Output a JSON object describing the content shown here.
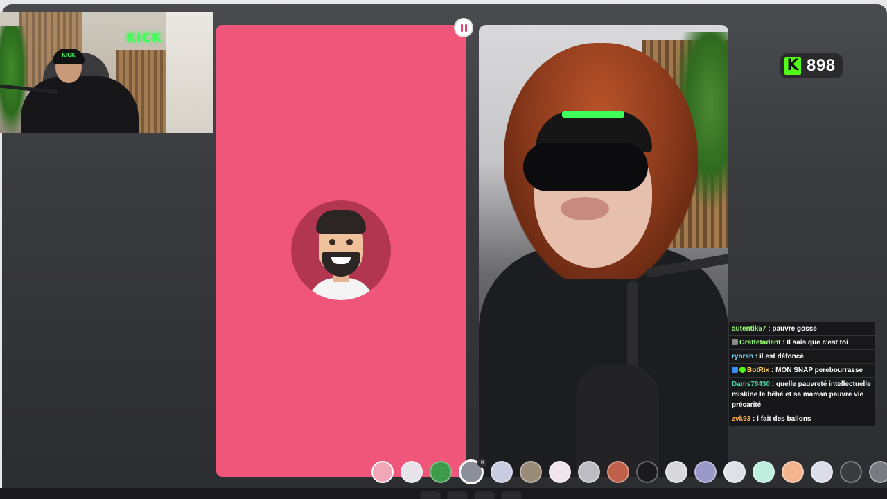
{
  "stream": {
    "viewer_count": "898",
    "kick_logo_letter": "K",
    "webcam_sign": "KICK",
    "webcam_cap": "KICK"
  },
  "call": {
    "pause_icon": "pause-icon",
    "accent_color": "#f0567a"
  },
  "chat": {
    "messages": [
      {
        "user": "autentik57",
        "text": " : pauvre gosse",
        "color": "#9cff7a",
        "badges": []
      },
      {
        "user": "Grattetadent",
        "text": " : Il sais que c'est toi",
        "color": "#9cff7a",
        "badges": [
          "pen-badge-icon"
        ]
      },
      {
        "user": "rynrah",
        "text": " : il est défoncé",
        "color": "#7fd8ff",
        "badges": []
      },
      {
        "user": "BotRix",
        "text": " : MON SNAP perebourrasse",
        "color": "#ffd24a",
        "badges": [
          "bot-badge-icon",
          "verified-badge-icon"
        ]
      },
      {
        "user": "Dams78430",
        "text": " : quelle pauvreté intellectuelle miskine le bébé et sa maman pauvre vie précarité",
        "color": "#4ad6a8",
        "badges": []
      },
      {
        "user": "zvk93",
        "text": " : l fait des ballons",
        "color": "#ffb14a",
        "badges": []
      }
    ]
  },
  "filters": {
    "items": [
      {
        "name": "filter-pink",
        "color": "#f2a7b8"
      },
      {
        "name": "filter-white-face",
        "color": "#e6e3ea"
      },
      {
        "name": "filter-green-alien",
        "color": "#3e9b4a"
      },
      {
        "name": "filter-selected-face",
        "color": "#8a8f9a"
      },
      {
        "name": "filter-pale-face",
        "color": "#c9cbe0"
      },
      {
        "name": "filter-bear",
        "color": "#9a8a78"
      },
      {
        "name": "filter-cute",
        "color": "#f0e4ec"
      },
      {
        "name": "filter-grey-face",
        "color": "#bcbcc2"
      },
      {
        "name": "filter-red-face",
        "color": "#c0604a"
      },
      {
        "name": "filter-devil",
        "color": "#1a1a1f"
      },
      {
        "name": "filter-sad",
        "color": "#d8d8dc"
      },
      {
        "name": "filter-purple",
        "color": "#9a98c8"
      },
      {
        "name": "filter-sparkle",
        "color": "#e0e0ea"
      },
      {
        "name": "filter-mint",
        "color": "#bdeede"
      },
      {
        "name": "filter-peach",
        "color": "#f3b48e"
      },
      {
        "name": "filter-stars",
        "color": "#dcdde8"
      },
      {
        "name": "filter-speed",
        "color": "#3a3b3e"
      },
      {
        "name": "filter-robot",
        "color": "#7a7b80"
      }
    ],
    "selected_index": 3,
    "close_glyph": "×"
  }
}
